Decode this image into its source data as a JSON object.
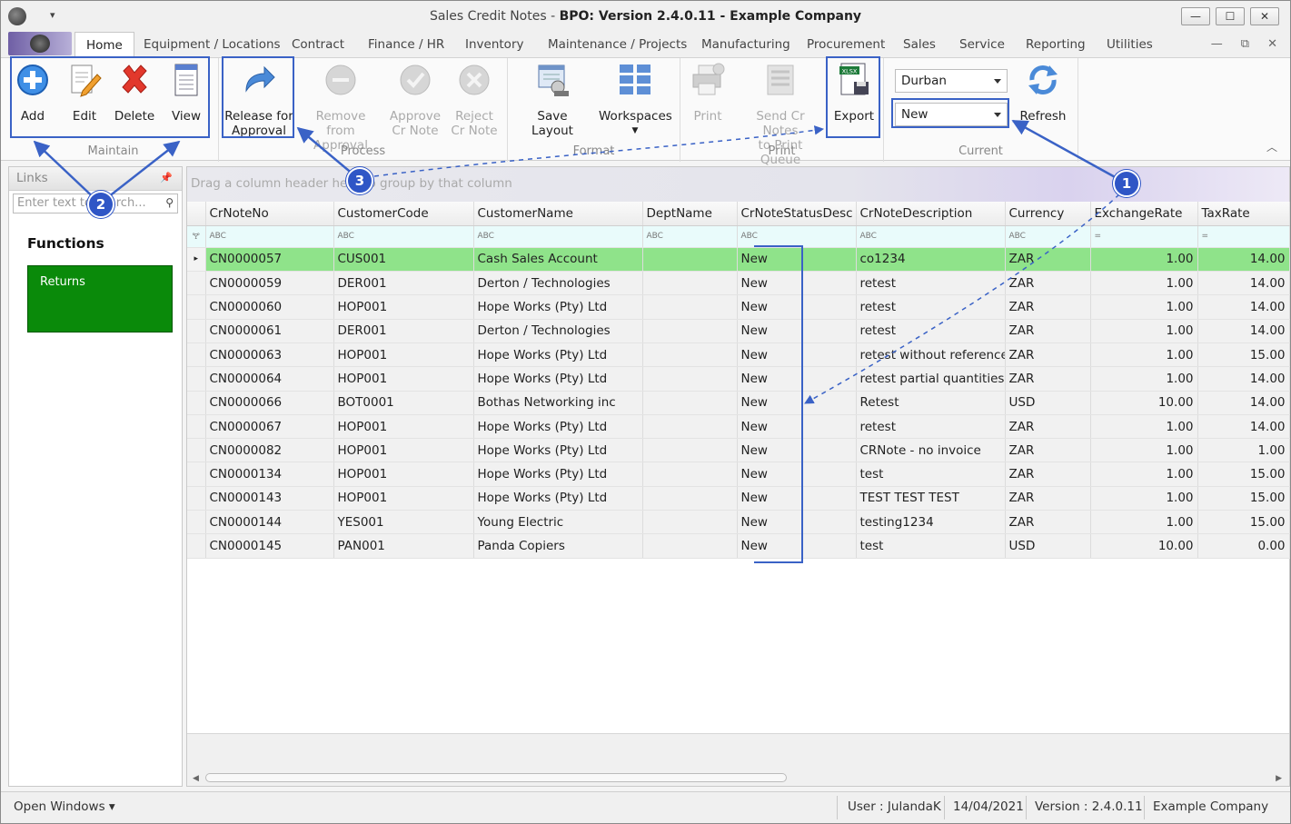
{
  "window": {
    "title_prefix": "Sales Credit Notes - ",
    "title_bold": "BPO: Version 2.4.0.11 - Example Company",
    "qat_label": "▾",
    "min": "—",
    "max": "☐",
    "close": "✕"
  },
  "menu": {
    "tabs": [
      "Home",
      "Equipment / Locations",
      "Contract",
      "Finance / HR",
      "Inventory",
      "Maintenance / Projects",
      "Manufacturing",
      "Procurement",
      "Sales",
      "Service",
      "Reporting",
      "Utilities"
    ],
    "mdi": [
      "—",
      "⧉",
      "✕"
    ]
  },
  "ribbon": {
    "maintain": {
      "label": "Maintain",
      "add": "Add",
      "edit": "Edit",
      "delete": "Delete",
      "view": "View"
    },
    "process": {
      "label": "Process",
      "release_1": "Release for",
      "release_2": "Approval",
      "remove_1": "Remove from",
      "remove_2": "Approval",
      "approve_1": "Approve",
      "approve_2": "Cr Note",
      "reject_1": "Reject",
      "reject_2": "Cr Note"
    },
    "format": {
      "label": "Format",
      "save_layout": "Save Layout",
      "workspaces": "Workspaces"
    },
    "print": {
      "label": "Print",
      "print": "Print",
      "send_1": "Send Cr Notes",
      "send_2": "to Print Queue",
      "export": "Export",
      "export_badge": "XLSX"
    },
    "current": {
      "label": "Current",
      "site": "Durban",
      "status": "New",
      "refresh": "Refresh"
    }
  },
  "links": {
    "header": "Links",
    "search_placeholder": "Enter text to search...",
    "functions_title": "Functions",
    "tile": "Returns"
  },
  "grid": {
    "group_hint": "Drag a column header here to group by that column",
    "filter_hint": "ABC",
    "filter_eq": "=",
    "columns": [
      "CrNoteNo",
      "CustomerCode",
      "CustomerName",
      "DeptName",
      "CrNoteStatusDesc",
      "CrNoteDescription",
      "Currency",
      "ExchangeRate",
      "TaxRate"
    ],
    "rows": [
      [
        "CN0000057",
        "CUS001",
        "Cash Sales Account",
        "",
        "New",
        "co1234",
        "ZAR",
        "1.00",
        "14.00"
      ],
      [
        "CN0000059",
        "DER001",
        "Derton / Technologies",
        "",
        "New",
        "retest",
        "ZAR",
        "1.00",
        "14.00"
      ],
      [
        "CN0000060",
        "HOP001",
        "Hope Works (Pty) Ltd",
        "",
        "New",
        "retest",
        "ZAR",
        "1.00",
        "14.00"
      ],
      [
        "CN0000061",
        "DER001",
        "Derton / Technologies",
        "",
        "New",
        "retest",
        "ZAR",
        "1.00",
        "14.00"
      ],
      [
        "CN0000063",
        "HOP001",
        "Hope Works (Pty) Ltd",
        "",
        "New",
        "retest without reference",
        "ZAR",
        "1.00",
        "15.00"
      ],
      [
        "CN0000064",
        "HOP001",
        "Hope Works (Pty) Ltd",
        "",
        "New",
        "retest partial quantities",
        "ZAR",
        "1.00",
        "14.00"
      ],
      [
        "CN0000066",
        "BOT0001",
        "Bothas Networking inc",
        "",
        "New",
        "Retest",
        "USD",
        "10.00",
        "14.00"
      ],
      [
        "CN0000067",
        "HOP001",
        "Hope Works (Pty) Ltd",
        "",
        "New",
        "retest",
        "ZAR",
        "1.00",
        "14.00"
      ],
      [
        "CN0000082",
        "HOP001",
        "Hope Works (Pty) Ltd",
        "",
        "New",
        "CRNote - no invoice",
        "ZAR",
        "1.00",
        "1.00"
      ],
      [
        "CN0000134",
        "HOP001",
        "Hope Works (Pty) Ltd",
        "",
        "New",
        "test",
        "ZAR",
        "1.00",
        "15.00"
      ],
      [
        "CN0000143",
        "HOP001",
        "Hope Works (Pty) Ltd",
        "",
        "New",
        "TEST TEST TEST",
        "ZAR",
        "1.00",
        "15.00"
      ],
      [
        "CN0000144",
        "YES001",
        "Young Electric",
        "",
        "New",
        "testing1234",
        "ZAR",
        "1.00",
        "15.00"
      ],
      [
        "CN0000145",
        "PAN001",
        "Panda Copiers",
        "",
        "New",
        "test",
        "USD",
        "10.00",
        "0.00"
      ]
    ]
  },
  "status": {
    "open_windows": "Open Windows ▾",
    "user": "User : JulandaK",
    "date": "14/04/2021",
    "version": "Version : 2.4.0.11",
    "company": "Example Company"
  },
  "annotations": {
    "b1": "1",
    "b2": "2",
    "b3": "3"
  },
  "colors": {
    "accent": "#3a62c6",
    "selected_row": "#8fe38a",
    "tile": "#0a8a0a"
  }
}
